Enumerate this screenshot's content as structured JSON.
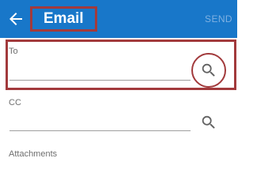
{
  "app_bar": {
    "title": "Email",
    "send_label": "SEND"
  },
  "fields": {
    "to": {
      "label": "To",
      "value": ""
    },
    "cc": {
      "label": "CC",
      "value": ""
    },
    "attachments": {
      "label": "Attachments"
    }
  },
  "colors": {
    "app_bar_bg": "#1877c9",
    "send_disabled": "#7fb1e2",
    "highlight": "#a23a3c"
  },
  "icons": {
    "back": "arrow-left-icon",
    "search": "magnifier-icon"
  }
}
